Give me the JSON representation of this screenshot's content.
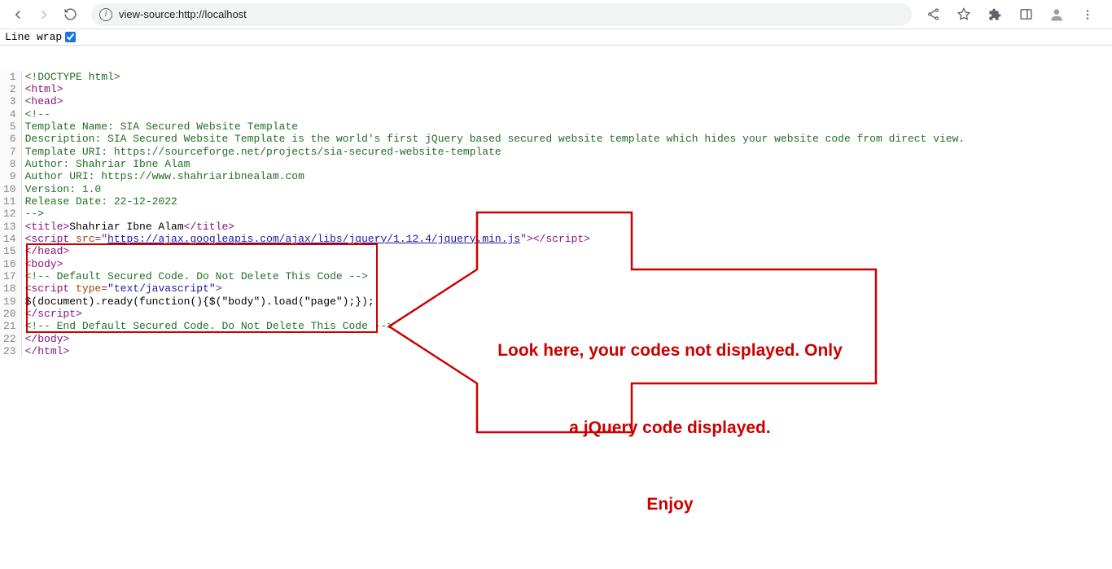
{
  "toolbar": {
    "url": "view-source:http://localhost"
  },
  "linewrap": {
    "label": "Line wrap",
    "checked": true
  },
  "source": {
    "lines": [
      {
        "n": "1",
        "segs": [
          {
            "c": "comment",
            "t": "<!DOCTYPE html>"
          }
        ]
      },
      {
        "n": "2",
        "segs": [
          {
            "c": "tag",
            "t": "<html>"
          }
        ]
      },
      {
        "n": "3",
        "segs": [
          {
            "c": "tag",
            "t": "<head>"
          }
        ]
      },
      {
        "n": "4",
        "segs": [
          {
            "c": "comment",
            "t": "<!--"
          }
        ]
      },
      {
        "n": "5",
        "segs": [
          {
            "c": "comment",
            "t": "Template Name: SIA Secured Website Template"
          }
        ]
      },
      {
        "n": "6",
        "segs": [
          {
            "c": "comment",
            "t": "Description: SIA Secured Website Template is the world's first jQuery based secured website template which hides your website code from direct view."
          }
        ]
      },
      {
        "n": "7",
        "segs": [
          {
            "c": "comment",
            "t": "Template URI: https://sourceforge.net/projects/sia-secured-website-template"
          }
        ]
      },
      {
        "n": "8",
        "segs": [
          {
            "c": "comment",
            "t": "Author: Shahriar Ibne Alam"
          }
        ]
      },
      {
        "n": "9",
        "segs": [
          {
            "c": "comment",
            "t": "Author URI: https://www.shahriaribnealam.com"
          }
        ]
      },
      {
        "n": "10",
        "segs": [
          {
            "c": "comment",
            "t": "Version: 1.0"
          }
        ]
      },
      {
        "n": "11",
        "segs": [
          {
            "c": "comment",
            "t": "Release Date: 22-12-2022"
          }
        ]
      },
      {
        "n": "12",
        "segs": [
          {
            "c": "comment",
            "t": "-->"
          }
        ]
      },
      {
        "n": "13",
        "segs": [
          {
            "c": "tag",
            "t": "<title>"
          },
          {
            "c": "txt",
            "t": "Shahriar Ibne Alam"
          },
          {
            "c": "tag",
            "t": "</title>"
          }
        ]
      },
      {
        "n": "14",
        "segs": [
          {
            "c": "tag",
            "t": "<script "
          },
          {
            "c": "attr",
            "t": "src"
          },
          {
            "c": "tag",
            "t": "=\""
          },
          {
            "c": "link",
            "t": "https://ajax.googleapis.com/ajax/libs/jquery/1.12.4/jquery.min.js"
          },
          {
            "c": "tag",
            "t": "\">"
          },
          {
            "c": "tag",
            "t": "</scr"
          },
          {
            "c": "tag",
            "t": "ipt>"
          }
        ]
      },
      {
        "n": "15",
        "segs": [
          {
            "c": "tag",
            "t": "</head>"
          }
        ]
      },
      {
        "n": "16",
        "segs": [
          {
            "c": "tag",
            "t": "<body>"
          }
        ]
      },
      {
        "n": "17",
        "segs": [
          {
            "c": "comment",
            "t": "<!-- Default Secured Code. Do Not Delete This Code -->"
          }
        ]
      },
      {
        "n": "18",
        "segs": [
          {
            "c": "tag",
            "t": "<script "
          },
          {
            "c": "attr",
            "t": "type"
          },
          {
            "c": "tag",
            "t": "="
          },
          {
            "c": "val",
            "t": "\"text/javascript\""
          },
          {
            "c": "tag",
            "t": ">"
          }
        ]
      },
      {
        "n": "19",
        "segs": [
          {
            "c": "txt",
            "t": "$(document).ready(function(){$(\"body\").load(\"page\");});"
          }
        ]
      },
      {
        "n": "20",
        "segs": [
          {
            "c": "tag",
            "t": "</scr"
          },
          {
            "c": "tag",
            "t": "ipt>"
          }
        ]
      },
      {
        "n": "21",
        "segs": [
          {
            "c": "comment",
            "t": "<!-- End Default Secured Code. Do Not Delete This Code -->"
          }
        ]
      },
      {
        "n": "22",
        "segs": [
          {
            "c": "tag",
            "t": "</body>"
          }
        ]
      },
      {
        "n": "23",
        "segs": [
          {
            "c": "tag",
            "t": "</html>"
          }
        ]
      }
    ]
  },
  "annotation": {
    "line1": "Look here, your codes not displayed. Only",
    "line2": "a jQuery code displayed.",
    "line3": "Enjoy"
  }
}
